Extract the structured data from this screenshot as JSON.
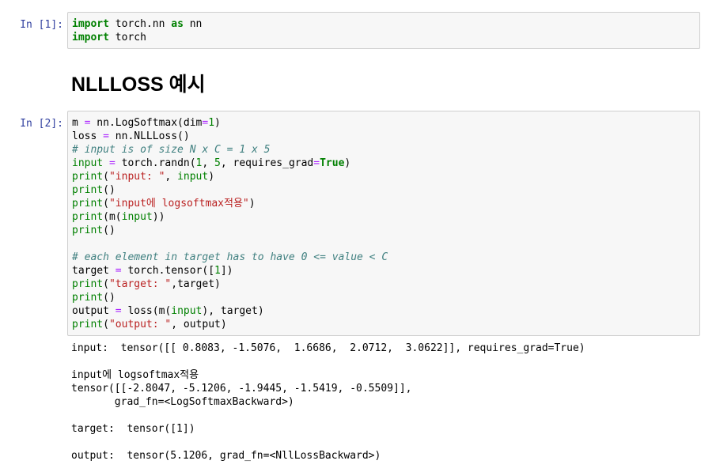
{
  "cell1": {
    "prompt": "In [1]:",
    "tokens": {
      "import1": "import",
      "mod1": " torch.nn ",
      "as": "as",
      "alias": " nn",
      "import2": "import",
      "mod2": " torch"
    }
  },
  "heading": "NLLLOSS 예시",
  "cell2": {
    "prompt": "In [2]:",
    "tokens": {
      "l1a": "m ",
      "l1op": "=",
      "l1b": " nn.LogSoftmax(dim",
      "l1op2": "=",
      "l1num": "1",
      "l1c": ")",
      "l2a": "loss ",
      "l2op": "=",
      "l2b": " nn.NLLLoss()",
      "l3": "# input is of size N x C = 1 x 5",
      "l4a": "input",
      "l4op": " = ",
      "l4b": "torch.randn(",
      "l4n1": "1",
      "l4c": ", ",
      "l4n2": "5",
      "l4d": ", requires_grad",
      "l4op2": "=",
      "l4true": "True",
      "l4e": ")",
      "l5a": "print",
      "l5b": "(",
      "l5str": "\"input: \"",
      "l5c": ", ",
      "l5d": "input",
      "l5e": ")",
      "l6a": "print",
      "l6b": "()",
      "l7a": "print",
      "l7b": "(",
      "l7str": "\"input에 logsoftmax적용\"",
      "l7c": ")",
      "l8a": "print",
      "l8b": "(m(",
      "l8c": "input",
      "l8d": "))",
      "l9a": "print",
      "l9b": "()",
      "l11": "# each element in target has to have 0 <= value < C",
      "l12a": "target ",
      "l12op": "=",
      "l12b": " torch.tensor([",
      "l12n": "1",
      "l12c": "])",
      "l13a": "print",
      "l13b": "(",
      "l13str": "\"target: \"",
      "l13c": ",target)",
      "l14a": "print",
      "l14b": "()",
      "l15a": "output ",
      "l15op": "=",
      "l15b": " loss(m(",
      "l15c": "input",
      "l15d": "), target)",
      "l16a": "print",
      "l16b": "(",
      "l16str": "\"output: \"",
      "l16c": ", output)"
    },
    "output": [
      "input:  tensor([[ 0.8083, -1.5076,  1.6686,  2.0712,  3.0622]], requires_grad=True)",
      "",
      "input에 logsoftmax적용",
      "tensor([[-2.8047, -5.1206, -1.9445, -1.5419, -0.5509]],",
      "       grad_fn=<LogSoftmaxBackward>)",
      "",
      "target:  tensor([1])",
      "",
      "output:  tensor(5.1206, grad_fn=<NllLossBackward>)"
    ]
  }
}
